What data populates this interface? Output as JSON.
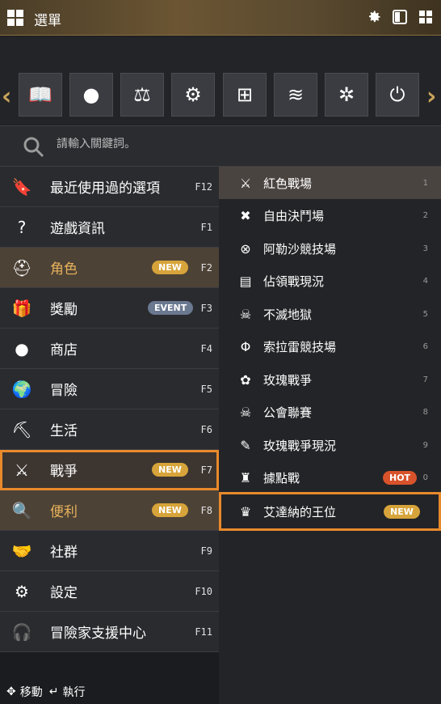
{
  "window": {
    "title": "選單"
  },
  "toolbar": {
    "settings_icon": "gear-icon",
    "window_icon": "window-icon",
    "grid_icon": "grid-icon"
  },
  "quick_bar": {
    "items": [
      {
        "icon": "book-icon"
      },
      {
        "icon": "coin-icon"
      },
      {
        "icon": "scale-icon"
      },
      {
        "icon": "gear-icon"
      },
      {
        "icon": "map-icon"
      },
      {
        "icon": "hand-water-icon"
      },
      {
        "icon": "network-icon"
      },
      {
        "icon": "power-icon"
      }
    ]
  },
  "search": {
    "placeholder": "請輸入關鍵詞。"
  },
  "left_menu": {
    "items": [
      {
        "label": "最近使用過的選項",
        "key": "F12"
      },
      {
        "label": "遊戲資訊",
        "key": "F1"
      },
      {
        "label": "角色",
        "key": "F2",
        "badge": "NEW"
      },
      {
        "label": "獎勵",
        "key": "F3",
        "badge": "EVENT"
      },
      {
        "label": "商店",
        "key": "F4"
      },
      {
        "label": "冒險",
        "key": "F5"
      },
      {
        "label": "生活",
        "key": "F6"
      },
      {
        "label": "戰爭",
        "key": "F7",
        "badge": "NEW"
      },
      {
        "label": "便利",
        "key": "F8",
        "badge": "NEW"
      },
      {
        "label": "社群",
        "key": "F9"
      },
      {
        "label": "設定",
        "key": "F10"
      },
      {
        "label": "冒險家支援中心",
        "key": "F11"
      }
    ]
  },
  "right_menu": {
    "items": [
      {
        "label": "紅色戰場",
        "key": "1"
      },
      {
        "label": "自由決鬥場",
        "key": "2"
      },
      {
        "label": "阿勒沙競技場",
        "key": "3"
      },
      {
        "label": "佔領戰現況",
        "key": "4"
      },
      {
        "label": "不滅地獄",
        "key": "5"
      },
      {
        "label": "索拉雷競技場",
        "key": "6"
      },
      {
        "label": "玫瑰戰爭",
        "key": "7"
      },
      {
        "label": "公會聯賽",
        "key": "8"
      },
      {
        "label": "玫瑰戰爭現況",
        "key": "9"
      },
      {
        "label": "據點戰",
        "key": "0",
        "badge": "HOT"
      },
      {
        "label": "艾達納的王位",
        "badge": "NEW"
      }
    ]
  },
  "bottom_bar": {
    "move_label": "移動",
    "execute_label": "執行"
  },
  "colors": {
    "accent": "#e88a2c",
    "gold": "#d6a43a",
    "hot": "#d8532b",
    "event": "#6a7890"
  }
}
